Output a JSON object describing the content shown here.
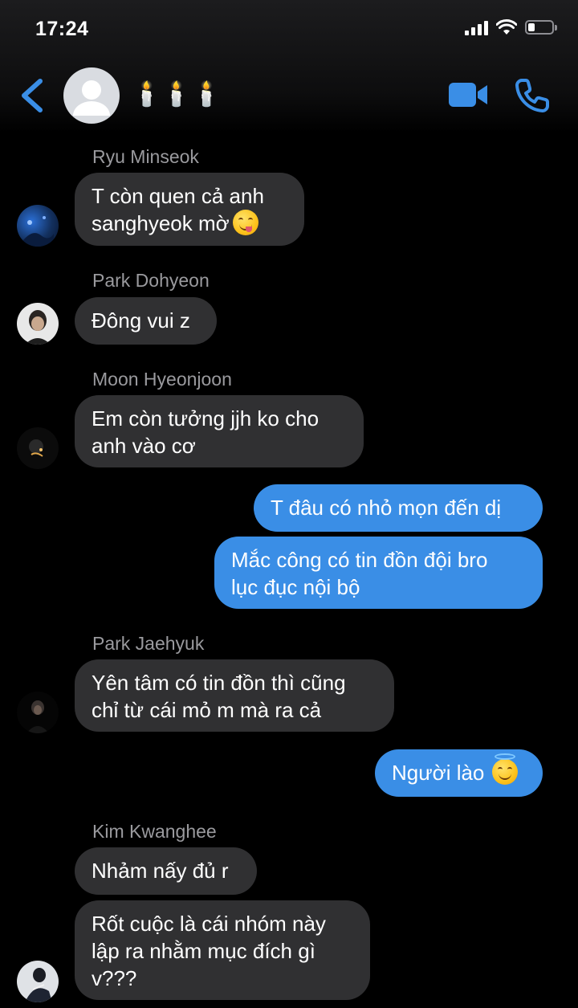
{
  "status_bar": {
    "time": "17:24",
    "battery_level": 0.3
  },
  "header": {
    "title": "🕯️🕯️🕯️",
    "back_icon": "chevron-left-icon",
    "avatar_icon": "default-person-avatar",
    "video_icon": "video-camera-icon",
    "call_icon": "phone-icon",
    "accent_color": "#3a8ee6"
  },
  "colors": {
    "incoming_bubble": "#303032",
    "outgoing_bubble": "#3a8ee6",
    "sender_name": "#9a9a9e",
    "background": "#000000"
  },
  "messages": [
    {
      "sender": "Ryu Minseok",
      "lines": [
        "T còn quen cả anh",
        "sanghyeok mờ"
      ],
      "emoji": "face-savoring-food"
    },
    {
      "sender": "Park Dohyeon",
      "lines": [
        "Đông vui z"
      ]
    },
    {
      "sender": "Moon Hyeonjoon",
      "lines": [
        "Em còn tưởng jjh ko cho",
        "anh vào cơ"
      ]
    },
    {
      "outgoing": true,
      "lines": [
        "T đâu có nhỏ mọn đến dị"
      ]
    },
    {
      "outgoing": true,
      "lines": [
        "Mắc công có tin đồn đội bro",
        "lục đục nội bộ"
      ]
    },
    {
      "sender": "Park Jaehyuk",
      "lines": [
        "Yên tâm có tin đồn thì cũng",
        "chỉ từ cái mỏ m mà ra cả"
      ]
    },
    {
      "outgoing": true,
      "lines": [
        "Người lào"
      ],
      "emoji": "smiling-face-with-halo"
    },
    {
      "sender": "Kim Kwanghee",
      "lines": [
        "Nhảm nấy đủ r"
      ]
    },
    {
      "sender": "Kim Kwanghee",
      "lines": [
        "Rốt cuộc là cái nhóm này",
        "lập ra nhằm mục đích gì",
        "v???"
      ]
    }
  ]
}
